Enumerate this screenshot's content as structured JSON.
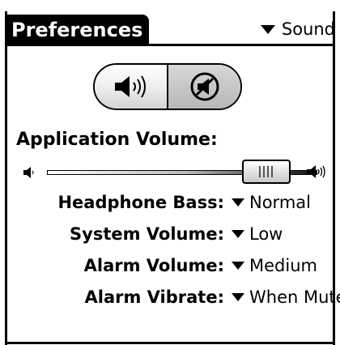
{
  "title": "Preferences",
  "category_picker": {
    "value": "Sound",
    "icon": "triangle-down-icon"
  },
  "speaker_toggle": {
    "options": [
      "sound-on-icon",
      "sound-muted-icon"
    ],
    "selected": "sound-muted-icon"
  },
  "app_volume": {
    "label": "Application Volume:",
    "level": 0.81
  },
  "rows": [
    {
      "label": "Headphone Bass:",
      "value": "Normal"
    },
    {
      "label": "System Volume:",
      "value": "Low"
    },
    {
      "label": "Alarm Volume:",
      "value": "Medium"
    },
    {
      "label": "Alarm Vibrate:",
      "value": "When Muted"
    }
  ]
}
